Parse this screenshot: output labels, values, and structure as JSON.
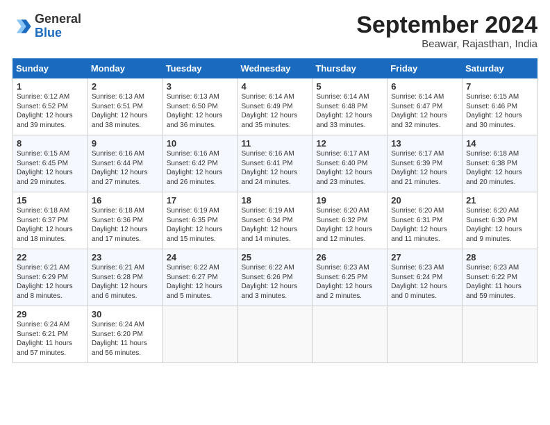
{
  "header": {
    "logo_general": "General",
    "logo_blue": "Blue",
    "month_title": "September 2024",
    "subtitle": "Beawar, Rajasthan, India"
  },
  "weekdays": [
    "Sunday",
    "Monday",
    "Tuesday",
    "Wednesday",
    "Thursday",
    "Friday",
    "Saturday"
  ],
  "weeks": [
    [
      {
        "day": "1",
        "info": "Sunrise: 6:12 AM\nSunset: 6:52 PM\nDaylight: 12 hours\nand 39 minutes."
      },
      {
        "day": "2",
        "info": "Sunrise: 6:13 AM\nSunset: 6:51 PM\nDaylight: 12 hours\nand 38 minutes."
      },
      {
        "day": "3",
        "info": "Sunrise: 6:13 AM\nSunset: 6:50 PM\nDaylight: 12 hours\nand 36 minutes."
      },
      {
        "day": "4",
        "info": "Sunrise: 6:14 AM\nSunset: 6:49 PM\nDaylight: 12 hours\nand 35 minutes."
      },
      {
        "day": "5",
        "info": "Sunrise: 6:14 AM\nSunset: 6:48 PM\nDaylight: 12 hours\nand 33 minutes."
      },
      {
        "day": "6",
        "info": "Sunrise: 6:14 AM\nSunset: 6:47 PM\nDaylight: 12 hours\nand 32 minutes."
      },
      {
        "day": "7",
        "info": "Sunrise: 6:15 AM\nSunset: 6:46 PM\nDaylight: 12 hours\nand 30 minutes."
      }
    ],
    [
      {
        "day": "8",
        "info": "Sunrise: 6:15 AM\nSunset: 6:45 PM\nDaylight: 12 hours\nand 29 minutes."
      },
      {
        "day": "9",
        "info": "Sunrise: 6:16 AM\nSunset: 6:44 PM\nDaylight: 12 hours\nand 27 minutes."
      },
      {
        "day": "10",
        "info": "Sunrise: 6:16 AM\nSunset: 6:42 PM\nDaylight: 12 hours\nand 26 minutes."
      },
      {
        "day": "11",
        "info": "Sunrise: 6:16 AM\nSunset: 6:41 PM\nDaylight: 12 hours\nand 24 minutes."
      },
      {
        "day": "12",
        "info": "Sunrise: 6:17 AM\nSunset: 6:40 PM\nDaylight: 12 hours\nand 23 minutes."
      },
      {
        "day": "13",
        "info": "Sunrise: 6:17 AM\nSunset: 6:39 PM\nDaylight: 12 hours\nand 21 minutes."
      },
      {
        "day": "14",
        "info": "Sunrise: 6:18 AM\nSunset: 6:38 PM\nDaylight: 12 hours\nand 20 minutes."
      }
    ],
    [
      {
        "day": "15",
        "info": "Sunrise: 6:18 AM\nSunset: 6:37 PM\nDaylight: 12 hours\nand 18 minutes."
      },
      {
        "day": "16",
        "info": "Sunrise: 6:18 AM\nSunset: 6:36 PM\nDaylight: 12 hours\nand 17 minutes."
      },
      {
        "day": "17",
        "info": "Sunrise: 6:19 AM\nSunset: 6:35 PM\nDaylight: 12 hours\nand 15 minutes."
      },
      {
        "day": "18",
        "info": "Sunrise: 6:19 AM\nSunset: 6:34 PM\nDaylight: 12 hours\nand 14 minutes."
      },
      {
        "day": "19",
        "info": "Sunrise: 6:20 AM\nSunset: 6:32 PM\nDaylight: 12 hours\nand 12 minutes."
      },
      {
        "day": "20",
        "info": "Sunrise: 6:20 AM\nSunset: 6:31 PM\nDaylight: 12 hours\nand 11 minutes."
      },
      {
        "day": "21",
        "info": "Sunrise: 6:20 AM\nSunset: 6:30 PM\nDaylight: 12 hours\nand 9 minutes."
      }
    ],
    [
      {
        "day": "22",
        "info": "Sunrise: 6:21 AM\nSunset: 6:29 PM\nDaylight: 12 hours\nand 8 minutes."
      },
      {
        "day": "23",
        "info": "Sunrise: 6:21 AM\nSunset: 6:28 PM\nDaylight: 12 hours\nand 6 minutes."
      },
      {
        "day": "24",
        "info": "Sunrise: 6:22 AM\nSunset: 6:27 PM\nDaylight: 12 hours\nand 5 minutes."
      },
      {
        "day": "25",
        "info": "Sunrise: 6:22 AM\nSunset: 6:26 PM\nDaylight: 12 hours\nand 3 minutes."
      },
      {
        "day": "26",
        "info": "Sunrise: 6:23 AM\nSunset: 6:25 PM\nDaylight: 12 hours\nand 2 minutes."
      },
      {
        "day": "27",
        "info": "Sunrise: 6:23 AM\nSunset: 6:24 PM\nDaylight: 12 hours\nand 0 minutes."
      },
      {
        "day": "28",
        "info": "Sunrise: 6:23 AM\nSunset: 6:22 PM\nDaylight: 11 hours\nand 59 minutes."
      }
    ],
    [
      {
        "day": "29",
        "info": "Sunrise: 6:24 AM\nSunset: 6:21 PM\nDaylight: 11 hours\nand 57 minutes."
      },
      {
        "day": "30",
        "info": "Sunrise: 6:24 AM\nSunset: 6:20 PM\nDaylight: 11 hours\nand 56 minutes."
      },
      null,
      null,
      null,
      null,
      null
    ]
  ]
}
